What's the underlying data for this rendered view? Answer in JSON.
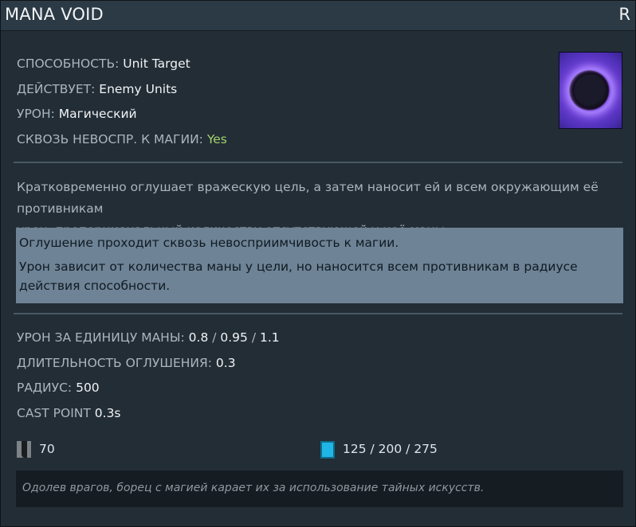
{
  "header": {
    "title": "MANA VOID",
    "hotkey": "R"
  },
  "info": [
    {
      "label": "СПОСОБНОСТЬ: ",
      "value": "Unit Target"
    },
    {
      "label": "ДЕЙСТВУЕТ: ",
      "value": "Enemy Units"
    },
    {
      "label": "УРОН: ",
      "value": "Магический"
    },
    {
      "label": "СКВОЗЬ НЕВОСПР. К МАГИИ: ",
      "value": "Yes"
    }
  ],
  "icon": "mana-void-ability-icon",
  "description_lines": [
    "Кратковременно оглушает вражескую цель, а затем наносит ей и всем окружающим её противникам",
    "урон, пропорциональный количеству отсутствующей у неё маны."
  ],
  "notes": [
    "Оглушение проходит сквозь невосприимчивость к магии.",
    "Урон зависит от количества маны у цели, но наносится всем противникам в радиусе действия способности."
  ],
  "stats": [
    {
      "label": "УРОН ЗА ЕДИНИЦУ МАНЫ: ",
      "values": [
        "0.8",
        "0.95",
        "1.1"
      ]
    },
    {
      "label": "ДЛИТЕЛЬНОСТЬ ОГЛУШЕНИЯ: ",
      "values": [
        "0.3"
      ]
    },
    {
      "label": "РАДИУС: ",
      "values": [
        "500"
      ]
    },
    {
      "label": "CAST POINT ",
      "values": [
        "0.3s"
      ]
    }
  ],
  "cooldown": {
    "icon": "cooldown-icon",
    "value": "70"
  },
  "mana_cost": {
    "icon": "mana-cost-icon",
    "value": "125 / 200 / 275"
  },
  "lore": "Одолев врагов, борец с магией карает их за использование тайных искусств.",
  "colors": {
    "yes": "#a4d36b",
    "mana": "#1fb6e6",
    "notes_bg": "#6e8395"
  }
}
